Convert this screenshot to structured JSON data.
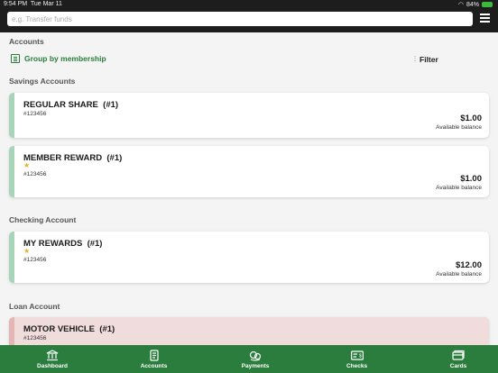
{
  "status_bar": {
    "time": "9:54 PM",
    "date": "Tue Mar 11",
    "battery": "84%"
  },
  "search": {
    "placeholder": "e.g. Transfer funds"
  },
  "accounts_header": "Accounts",
  "group_label": "Group by membership",
  "filter_label": "Filter",
  "sections": {
    "savings": "Savings Accounts",
    "checking": "Checking Account",
    "loan": "Loan Account"
  },
  "accounts": [
    {
      "name": "REGULAR SHARE",
      "index": "(#1)",
      "star": "",
      "number": "#123456",
      "balance": "$1.00",
      "caption": "Available balance"
    },
    {
      "name": "MEMBER REWARD",
      "index": "(#1)",
      "star": "★",
      "number": "#123456",
      "balance": "$1.00",
      "caption": "Available balance"
    },
    {
      "name": "MY REWARDS",
      "index": "(#1)",
      "star": "★",
      "number": "#123456",
      "balance": "$12.00",
      "caption": "Available balance"
    },
    {
      "name": "MOTOR VEHICLE",
      "index": "(#1)",
      "star": "",
      "number": "#123456",
      "balance": "",
      "caption": ""
    }
  ],
  "nav": [
    {
      "label": "Dashboard",
      "icon": "bank-icon"
    },
    {
      "label": "Accounts",
      "icon": "document-icon"
    },
    {
      "label": "Payments",
      "icon": "payments-icon"
    },
    {
      "label": "Checks",
      "icon": "check-icon"
    },
    {
      "label": "Cards",
      "icon": "card-icon"
    }
  ],
  "colors": {
    "brand_green": "#2a7d3c",
    "savings_accent": "#a8d5ba",
    "loan_bg": "#f1dcdc",
    "star": "#e6b422"
  }
}
